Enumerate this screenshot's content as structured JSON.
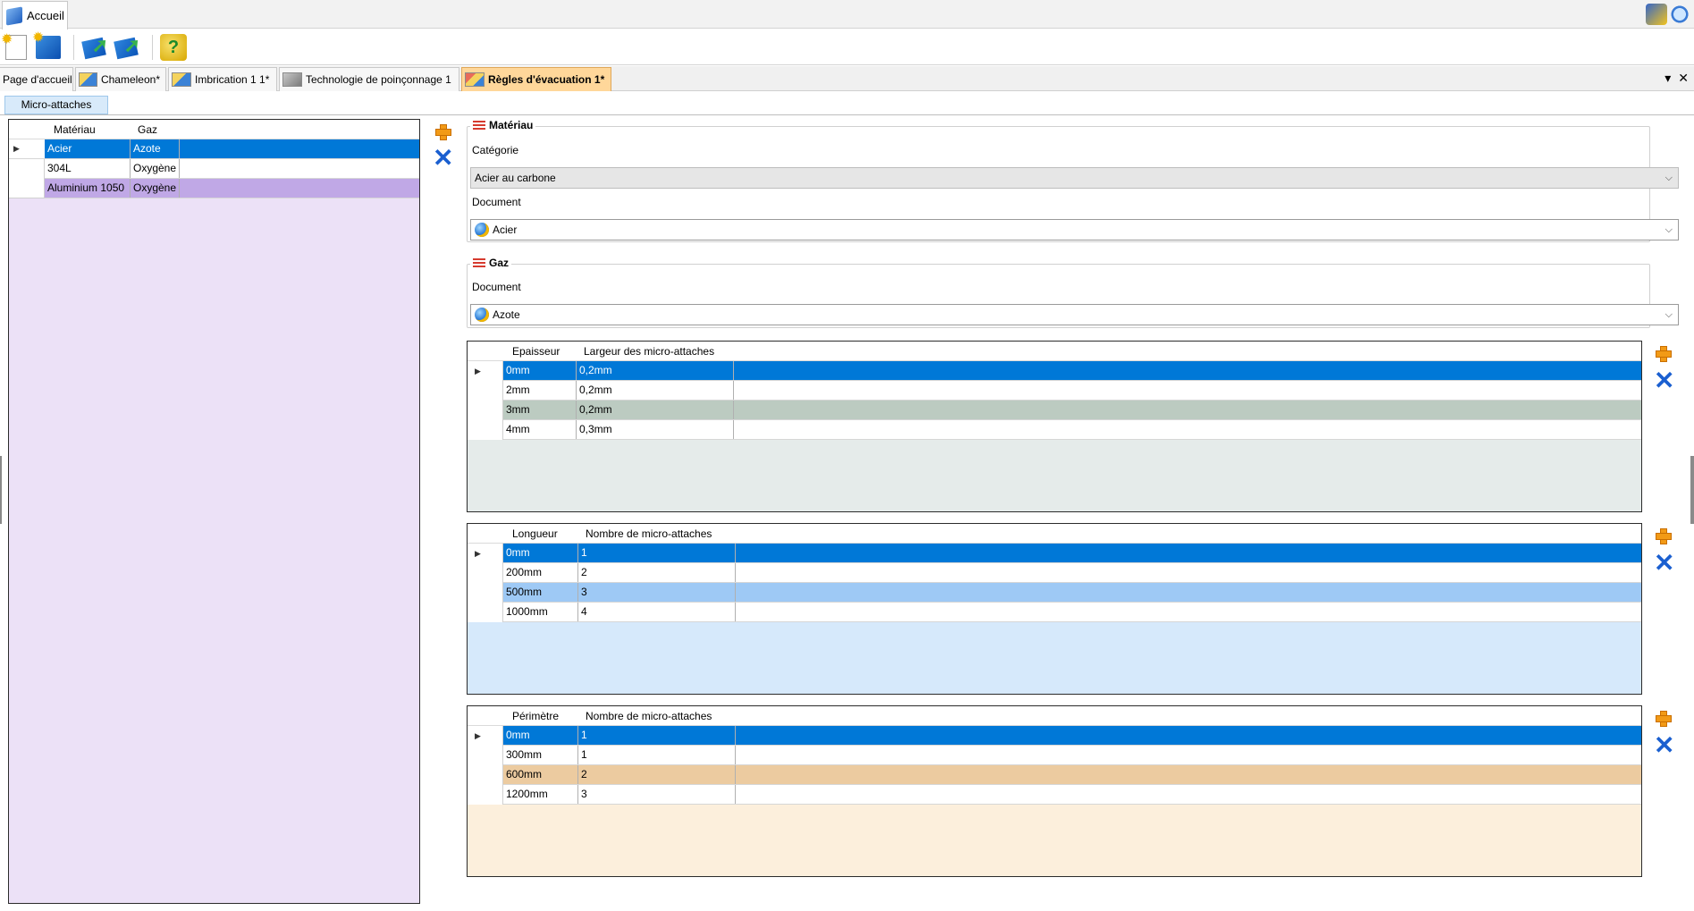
{
  "ribbon": {
    "tab_label": "Accueil"
  },
  "doc_tabs": [
    {
      "label": "Page d'accueil",
      "icon": "none"
    },
    {
      "label": "Chameleon*",
      "icon": "chameleon-icon"
    },
    {
      "label": "Imbrication 1 1*",
      "icon": "nesting-icon"
    },
    {
      "label": "Technologie de poinçonnage 1",
      "icon": "punch-tech-icon"
    },
    {
      "label": "Règles d'évacuation 1*",
      "icon": "evacuation-icon"
    }
  ],
  "tabs_controls": {
    "menu": "▾",
    "close": "✕"
  },
  "section_tab": "Micro-attaches",
  "material_grid": {
    "headers": [
      "Matériau",
      "Gaz"
    ],
    "rows": [
      [
        "Acier",
        "Azote"
      ],
      [
        "304L",
        "Oxygène"
      ],
      [
        "Aluminium 1050",
        "Oxygène"
      ]
    ]
  },
  "materiau_group": {
    "title": "Matériau",
    "categorie_label": "Catégorie",
    "categorie_value": "Acier au carbone",
    "document_label": "Document",
    "document_value": "Acier"
  },
  "gaz_group": {
    "title": "Gaz",
    "document_label": "Document",
    "document_value": "Azote"
  },
  "thickness_grid": {
    "headers": [
      "Epaisseur",
      "Largeur des micro-attaches"
    ],
    "rows": [
      [
        "0mm",
        "0,2mm"
      ],
      [
        "2mm",
        "0,2mm"
      ],
      [
        "3mm",
        "0,2mm"
      ],
      [
        "4mm",
        "0,3mm"
      ]
    ]
  },
  "length_grid": {
    "headers": [
      "Longueur",
      "Nombre de micro-attaches"
    ],
    "rows": [
      [
        "0mm",
        "1"
      ],
      [
        "200mm",
        "2"
      ],
      [
        "500mm",
        "3"
      ],
      [
        "1000mm",
        "4"
      ]
    ]
  },
  "perimeter_grid": {
    "headers": [
      "Périmètre",
      "Nombre de micro-attaches"
    ],
    "rows": [
      [
        "0mm",
        "1"
      ],
      [
        "300mm",
        "1"
      ],
      [
        "600mm",
        "2"
      ],
      [
        "1200mm",
        "3"
      ]
    ]
  },
  "colors": {
    "selection": "#0078d7",
    "material_bg": "#ece1f7",
    "material_highlight": "#c0a8e6",
    "thickness_bg": "#e5ebea",
    "thickness_highlight": "#bccbc1",
    "length_bg": "#d6e9fb",
    "length_highlight": "#9ec9f5",
    "perimeter_bg": "#fcefdc",
    "perimeter_highlight": "#eccba0"
  }
}
